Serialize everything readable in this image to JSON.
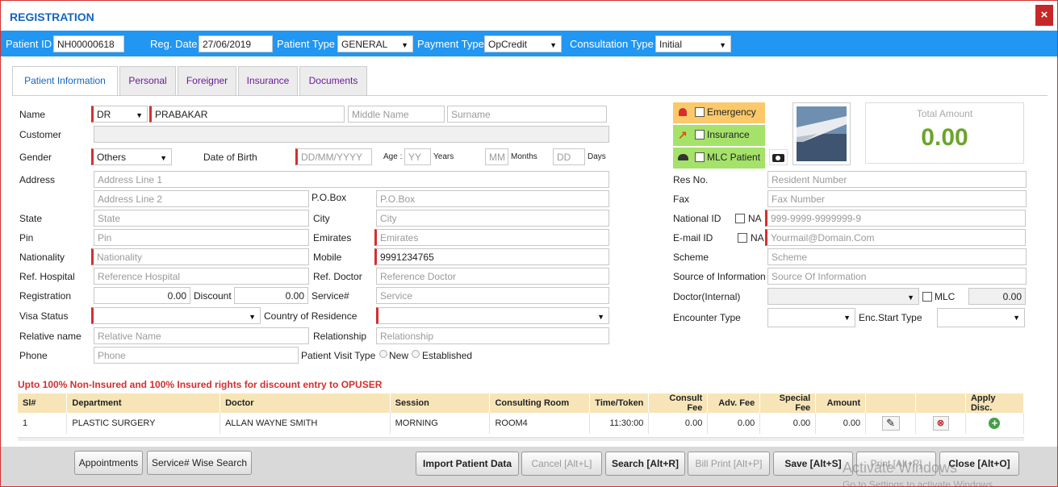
{
  "window": {
    "title": "REGISTRATION",
    "close": "×"
  },
  "header": {
    "patient_id_label": "Patient ID",
    "patient_id": "NH00000618",
    "reg_date_label": "Reg. Date",
    "reg_date": "27/06/2019",
    "patient_type_label": "Patient Type",
    "patient_type": "GENERAL",
    "payment_type_label": "Payment Type",
    "payment_type": "OpCredit",
    "consultation_type_label": "Consultation Type",
    "consultation_type": "Initial"
  },
  "tabs": [
    "Patient Information",
    "Personal",
    "Foreigner",
    "Insurance",
    "Documents"
  ],
  "form": {
    "name_label": "Name",
    "title": "DR",
    "first_name": "PRABAKAR",
    "middle_ph": "Middle Name",
    "surname_ph": "Surname",
    "customer_label": "Customer",
    "gender_label": "Gender",
    "gender": "Others",
    "dob_label": "Date of Birth",
    "dob_ph": "DD/MM/YYYY",
    "age_label": "Age :",
    "yy_ph": "YY",
    "years": "Years",
    "mm_ph": "MM",
    "months": "Months",
    "dd_ph": "DD",
    "days": "Days",
    "address_label": "Address",
    "addr1_ph": "Address Line 1",
    "addr2_ph": "Address Line 2",
    "pobox_label": "P.O.Box",
    "pobox_ph": "P.O.Box",
    "state_label": "State",
    "state_ph": "State",
    "city_label": "City",
    "city_ph": "City",
    "pin_label": "Pin",
    "pin_ph": "Pin",
    "emirates_label": "Emirates",
    "emirates_ph": "Emirates",
    "nationality_label": "Nationality",
    "nationality_ph": "Nationality",
    "mobile_label": "Mobile",
    "mobile": "9991234765",
    "refhosp_label": "Ref. Hospital",
    "refhosp_ph": "Reference Hospital",
    "refdoc_label": "Ref. Doctor",
    "refdoc_ph": "Reference Doctor",
    "registration_label": "Registration",
    "registration": "0.00",
    "discount_label": "Discount",
    "discount": "0.00",
    "service_label": "Service#",
    "service_ph": "Service",
    "visa_label": "Visa Status",
    "country_label": "Country of Residence",
    "relname_label": "Relative name",
    "relname_ph": "Relative Name",
    "relationship_label": "Relationship",
    "relationship_ph": "Relationship",
    "phone_label": "Phone",
    "phone_ph": "Phone",
    "visit_type_label": "Patient Visit Type",
    "visit_new": "New",
    "visit_established": "Established"
  },
  "flags": {
    "emergency": "Emergency",
    "insurance": "Insurance",
    "mlc": "MLC Patient"
  },
  "total": {
    "label": "Total Amount",
    "value": "0.00"
  },
  "right": {
    "res_label": "Res No.",
    "res_ph": "Resident Number",
    "fax_label": "Fax",
    "fax_ph": "Fax Number",
    "natid_label": "National ID",
    "na": "NA",
    "natid_ph": "999-9999-9999999-9",
    "email_label": "E-mail ID",
    "email_ph": "Yourmail@Domain.Com",
    "scheme_label": "Scheme",
    "scheme_ph": "Scheme",
    "source_label": "Source of Information",
    "source_ph": "Source Of Information",
    "docint_label": "Doctor(Internal)",
    "mlc_label": "MLC",
    "mlc_amount": "0.00",
    "enc_label": "Encounter Type",
    "encstart_label": "Enc.Start Type"
  },
  "notice": "Upto 100% Non-Insured and 100% Insured rights for discount entry to OPUSER",
  "table": {
    "headers": [
      "Sl#",
      "Department",
      "Doctor",
      "Session",
      "Consulting Room",
      "Time/Token",
      "Consult Fee",
      "Adv. Fee",
      "Special Fee",
      "Amount",
      "",
      "",
      "Apply Disc."
    ],
    "rows": [
      [
        "1",
        "PLASTIC SURGERY",
        "ALLAN WAYNE SMITH",
        "MORNING",
        "ROOM4",
        "11:30:00",
        "0.00",
        "0.00",
        "0.00",
        "0.00"
      ]
    ]
  },
  "footer": {
    "appointments": "Appointments",
    "service_search": "Service# Wise Search",
    "import": "Import Patient Data",
    "cancel": "Cancel [Alt+L]",
    "search": "Search [Alt+R]",
    "bill_print": "Bill Print [Alt+P]",
    "save": "Save [Alt+S]",
    "print": "Print [Alt+P]",
    "close": "Close [Alt+O]",
    "watermark1": "Activate Windows",
    "watermark2": "Go to Settings to activate Windows."
  }
}
